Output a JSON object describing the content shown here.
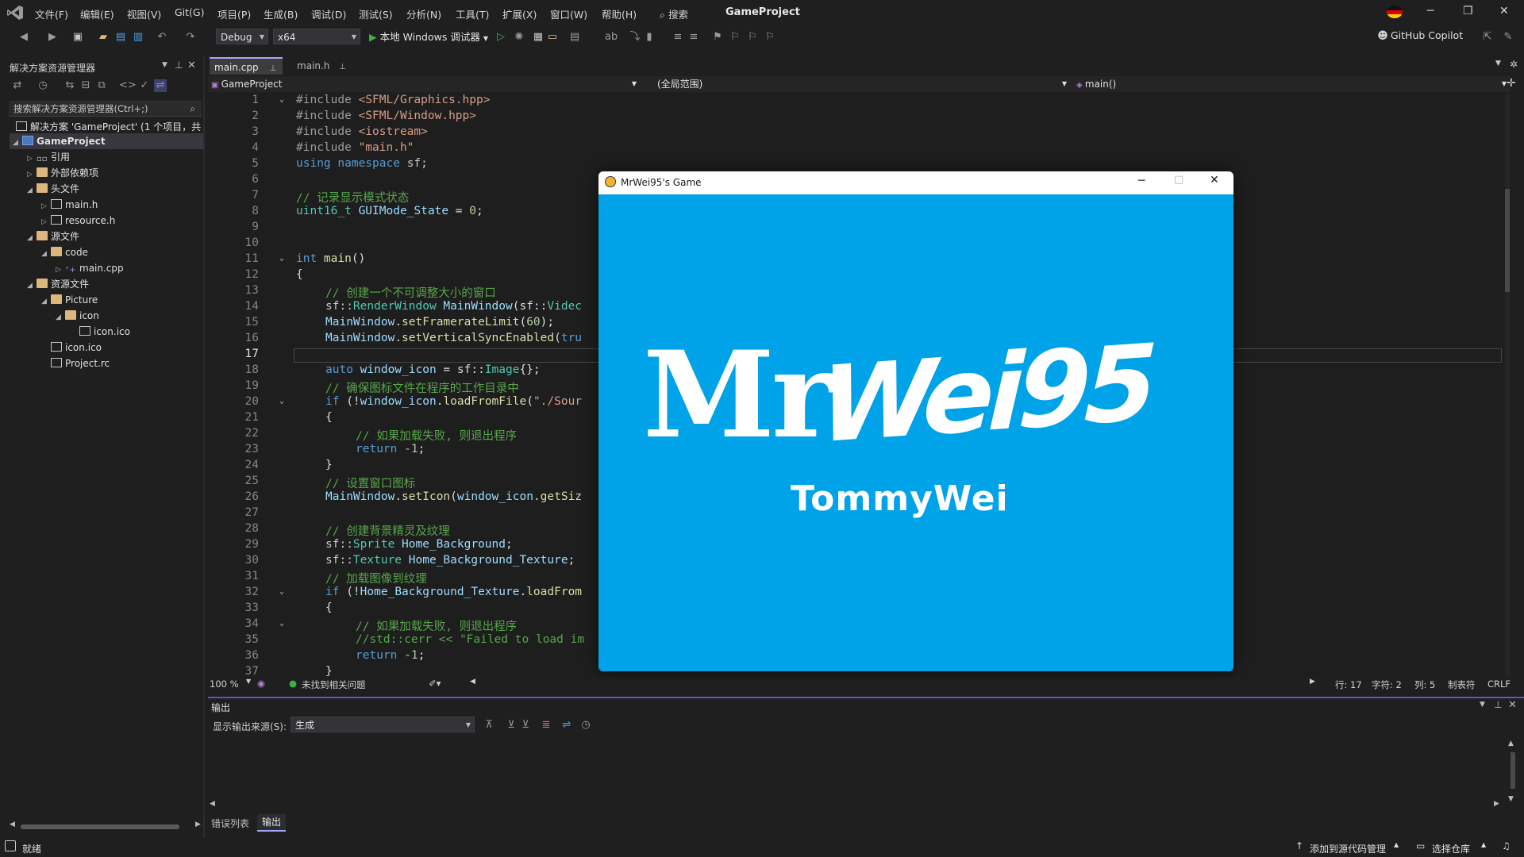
{
  "menubar": {
    "items": [
      "文件(F)",
      "编辑(E)",
      "视图(V)",
      "Git(G)",
      "项目(P)",
      "生成(B)",
      "调试(D)",
      "测试(S)",
      "分析(N)",
      "工具(T)",
      "扩展(X)",
      "窗口(W)",
      "帮助(H)"
    ],
    "search": "搜索",
    "app_title": "GameProject",
    "minimize": "─",
    "restore": "❐",
    "close": "✕"
  },
  "toolbar": {
    "config": "Debug",
    "platform": "x64",
    "run_label": "本地 Windows 调试器",
    "copilot": "GitHub Copilot"
  },
  "solution_explorer": {
    "title": "解决方案资源管理器",
    "search_placeholder": "搜索解决方案资源管理器(Ctrl+;)",
    "solution_label": "解决方案 'GameProject' (1 个项目，共",
    "project": "GameProject",
    "items": [
      "引用",
      "外部依赖项",
      "头文件",
      "main.h",
      "resource.h",
      "源文件",
      "code",
      "main.cpp",
      "资源文件",
      "Picture",
      "icon",
      "icon.ico",
      "icon.ico",
      "Project.rc"
    ]
  },
  "editor": {
    "tabs": [
      "main.cpp",
      "main.h"
    ],
    "nav_project": "GameProject",
    "nav_scope": "(全局范围)",
    "nav_member": "main()",
    "line_numbers": [
      "1",
      "2",
      "3",
      "4",
      "5",
      "6",
      "7",
      "8",
      "9",
      "10",
      "11",
      "12",
      "13",
      "14",
      "15",
      "16",
      "17",
      "18",
      "19",
      "20",
      "21",
      "22",
      "23",
      "24",
      "25",
      "26",
      "27",
      "28",
      "29",
      "30",
      "31",
      "32",
      "33",
      "34",
      "35",
      "36",
      "37"
    ],
    "code": {
      "l1a": "#include ",
      "l1b": "<SFML/Graphics.hpp>",
      "l2a": "#include ",
      "l2b": "<SFML/Window.hpp>",
      "l3a": "#include ",
      "l3b": "<iostream>",
      "l4a": "#include ",
      "l4b": "\"main.h\"",
      "l5a": "using namespace ",
      "l5b": "sf;",
      "l7": "// 记录显示模式状态",
      "l8a": "uint16_t ",
      "l8b": "GUIMode_State",
      "l8c": " = ",
      "l8d": "0",
      "l8e": ";",
      "l11a": "int ",
      "l11b": "main",
      "l11c": "()",
      "l12": "{",
      "l13": "// 创建一个不可调整大小的窗口",
      "l14a": "sf::",
      "l14b": "RenderWindow ",
      "l14c": "MainWindow",
      "l14d": "(sf::",
      "l14e": "Videc",
      "l15a": "MainWindow",
      "l15b": ".",
      "l15c": "setFramerateLimit",
      "l15d": "(",
      "l15e": "60",
      "l15f": ");",
      "l16a": "MainWindow",
      "l16b": ".",
      "l16c": "setVerticalSyncEnabled",
      "l16d": "(",
      "l16e": "tru",
      "l18a": "auto ",
      "l18b": "window_icon",
      "l18c": " = sf::",
      "l18d": "Image",
      "l18e": "{};",
      "l19": "// 确保图标文件在程序的工作目录中",
      "l20a": "if ",
      "l20b": "(!",
      "l20c": "window_icon",
      "l20d": ".",
      "l20e": "loadFromFile",
      "l20f": "(",
      "l20g": "\"./Sour",
      "l21": "{",
      "l22": "// 如果加载失败, 则退出程序",
      "l23a": "return ",
      "l23b": "-1",
      "l23c": ";",
      "l24": "}",
      "l25": "// 设置窗口图标",
      "l26a": "MainWindow",
      "l26b": ".",
      "l26c": "setIcon",
      "l26d": "(",
      "l26e": "window_icon",
      "l26f": ".",
      "l26g": "getSiz",
      "l28": "// 创建背景精灵及纹理",
      "l29a": "sf::",
      "l29b": "Sprite ",
      "l29c": "Home_Background",
      "l29d": ";",
      "l30a": "sf::",
      "l30b": "Texture ",
      "l30c": "Home_Background_Texture",
      "l30d": ";",
      "l31": "// 加载图像到纹理",
      "l32a": "if ",
      "l32b": "(!",
      "l32c": "Home_Background_Texture",
      "l32d": ".",
      "l32e": "loadFrom",
      "l33": "{",
      "l34": "// 如果加载失败, 则退出程序",
      "l35": "//std::cerr << \"Failed to load im",
      "l36a": "return ",
      "l36b": "-1",
      "l36c": ";",
      "l37": "}"
    }
  },
  "editor_status": {
    "zoom": "100 %",
    "issues": "未找到相关问题",
    "line": "行: 17",
    "char": "字符: 2",
    "col": "列: 5",
    "tabs": "制表符",
    "eol": "CRLF"
  },
  "output": {
    "title": "输出",
    "source_label": "显示输出来源(S):",
    "source_value": "生成"
  },
  "bottom_tabs": [
    "错误列表",
    "输出"
  ],
  "statusbar": {
    "ready": "就绪",
    "source_control": "添加到源代码管理",
    "repo": "选择仓库"
  },
  "game_window": {
    "title": "MrWei95's Game",
    "logo_mr": "Mr",
    "logo_wei": "Wei95",
    "logo_name": "TommyWei"
  }
}
